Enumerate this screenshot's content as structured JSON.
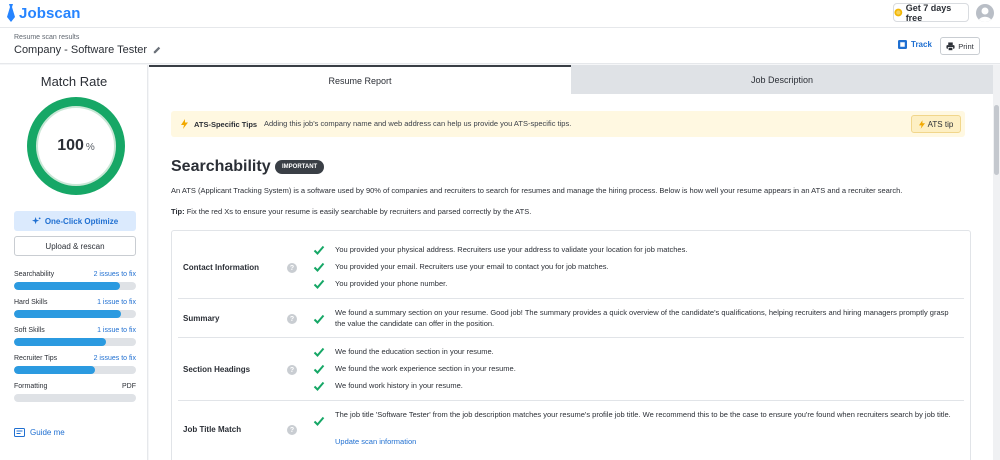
{
  "app": {
    "name": "Jobscan"
  },
  "topbar": {
    "cta_label": "Get 7 days free"
  },
  "header": {
    "eyebrow": "Resume scan results",
    "title": "Company - Software Tester",
    "track_label": "Track",
    "print_label": "Print"
  },
  "sidebar": {
    "match_title": "Match Rate",
    "match_value": "100",
    "match_unit": "%",
    "match_fraction": 1.0,
    "optimize_label": "One-Click Optimize",
    "rescan_label": "Upload & rescan",
    "metrics": [
      {
        "label": "Searchability",
        "status": "2 issues to fix",
        "progress": 0.87
      },
      {
        "label": "Hard Skills",
        "status": "1 issue to fix",
        "progress": 0.88
      },
      {
        "label": "Soft Skills",
        "status": "1 issue to fix",
        "progress": 0.75
      },
      {
        "label": "Recruiter Tips",
        "status": "2 issues to fix",
        "progress": 0.66
      },
      {
        "label": "Formatting",
        "status": "PDF",
        "progress": 0.0
      }
    ],
    "guide_label": "Guide me"
  },
  "tabs": [
    {
      "label": "Resume Report",
      "active": true
    },
    {
      "label": "Job Description",
      "active": false
    }
  ],
  "tips": {
    "title": "ATS-Specific Tips",
    "text": "Adding this job's company name and web address can help us provide you ATS-specific tips.",
    "button_label": "ATS tip"
  },
  "section": {
    "title": "Searchability",
    "badge": "IMPORTANT",
    "description": "An ATS (Applicant Tracking System) is a software used by 90% of companies and recruiters to search for resumes and manage the hiring process. Below is how well your resume appears in an ATS and a recruiter search.",
    "tip_label": "Tip:",
    "tip_text": " Fix the red Xs to ensure your resume is easily searchable by recruiters and parsed correctly by the ATS."
  },
  "rows": [
    {
      "label": "Contact Information",
      "items": [
        "You provided your physical address. Recruiters use your address to validate your location for job matches.",
        "You provided your email. Recruiters use your email to contact you for job matches.",
        "You provided your phone number."
      ]
    },
    {
      "label": "Summary",
      "items": [
        "We found a summary section on your resume. Good job! The summary provides a quick overview of the candidate's qualifications, helping recruiters and hiring managers promptly grasp the value the candidate can offer in the position."
      ]
    },
    {
      "label": "Section Headings",
      "items": [
        "We found the education section in your resume.",
        "We found the work experience section in your resume.",
        "We found work history in your resume."
      ]
    },
    {
      "label": "Job Title Match",
      "items": [
        "The job title 'Software Tester' from the job description matches your resume's profile job title. We recommend this to be the case to ensure you're found when recruiters search by job title."
      ],
      "link_label": "Update scan information"
    }
  ],
  "colors": {
    "accent": "#1f6fd1",
    "success": "#16a766",
    "bar": "#2b9ae0"
  }
}
